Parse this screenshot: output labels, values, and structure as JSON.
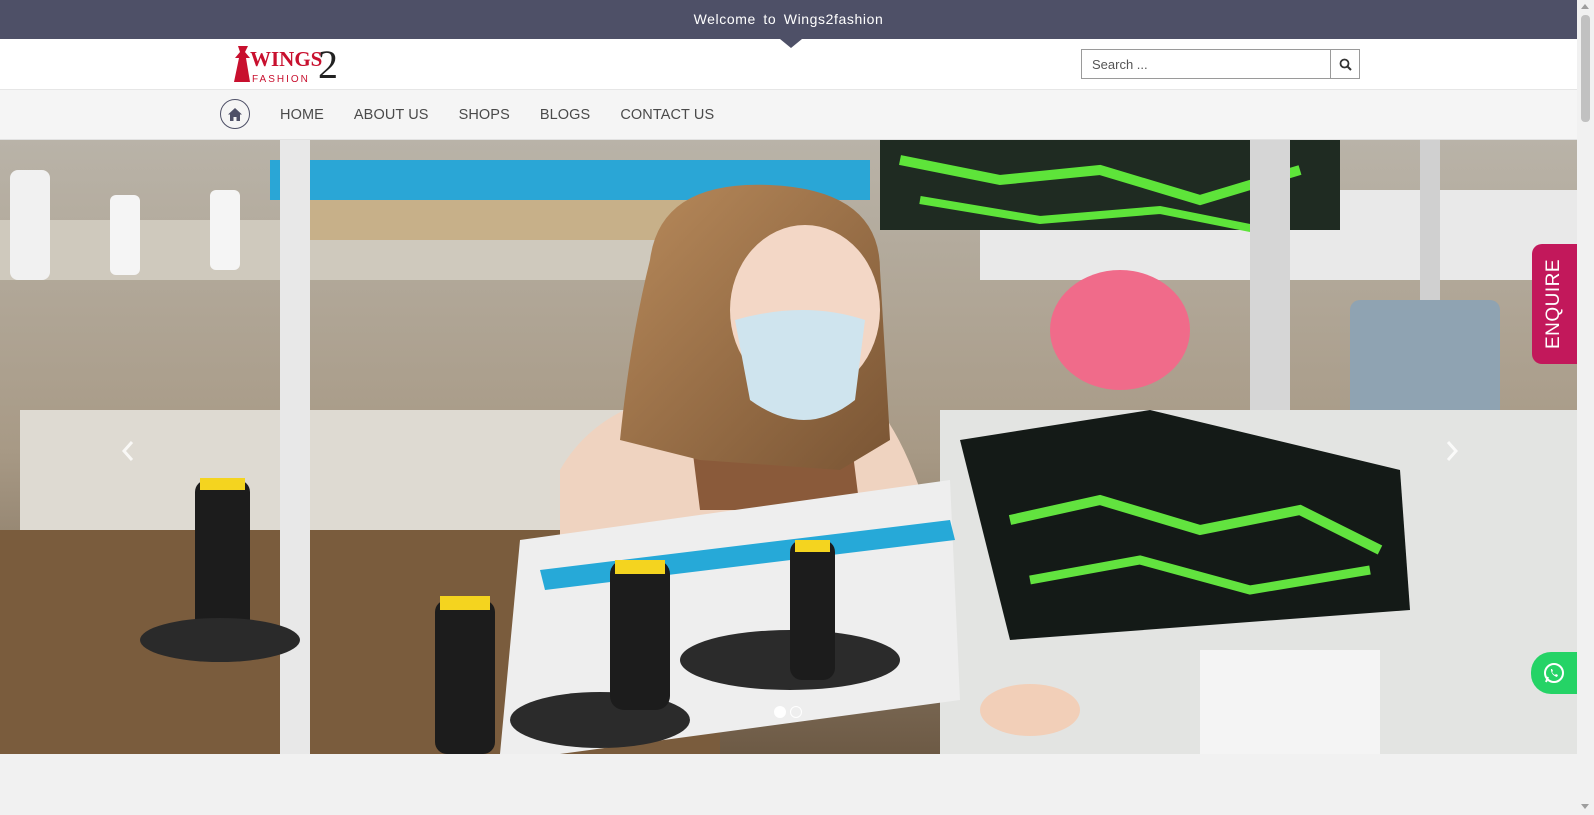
{
  "topbar": {
    "welcome_text": "Welcome to Wings2fashion"
  },
  "header": {
    "logo": {
      "top_word": "WINGS",
      "digit": "2",
      "bottom_word": "FASHION"
    },
    "search": {
      "placeholder": "Search ...",
      "icon": "search-icon"
    }
  },
  "nav": {
    "home_icon": "home-icon",
    "items": [
      {
        "label": "HOME"
      },
      {
        "label": "ABOUT US"
      },
      {
        "label": "SHOPS"
      },
      {
        "label": "BLOGS"
      },
      {
        "label": "CONTACT US"
      }
    ]
  },
  "hero": {
    "slides": 2,
    "active_slide": 1,
    "prev_icon": "chevron-left-icon",
    "next_icon": "chevron-right-icon"
  },
  "side_tabs": {
    "enquire_label": "ENQUIRE",
    "whatsapp_icon": "whatsapp-icon"
  },
  "colors": {
    "topbar_bg": "#4e5067",
    "enquire_bg": "#c2185b",
    "whatsapp_bg": "#25d366",
    "logo_red": "#c8102e"
  }
}
